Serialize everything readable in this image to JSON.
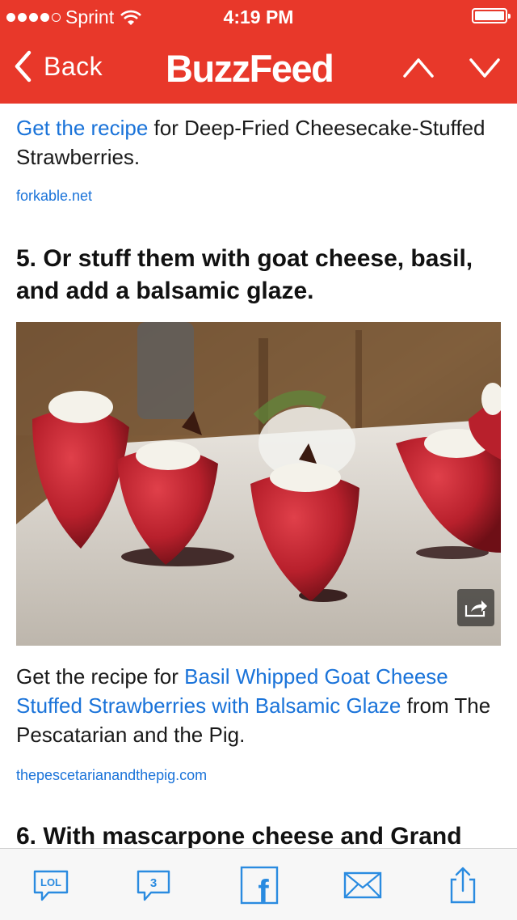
{
  "status": {
    "carrier": "Sprint",
    "time": "4:19 PM",
    "signal_bars": 4
  },
  "nav": {
    "back_label": "Back",
    "logo": "BuzzFeed"
  },
  "article": {
    "item4": {
      "link_text": "Get the recipe",
      "rest_text": " for Deep-Fried Cheesecake-Stuffed Strawberries.",
      "source": "forkable.net"
    },
    "item5": {
      "heading": "5. Or stuff them with goat cheese, basil, and add a balsamic glaze.",
      "image_alt": "Strawberries stuffed with goat cheese and balsamic glaze",
      "prefix": "Get the recipe for ",
      "link_text": "Basil Whipped Goat Cheese Stuffed Strawberries with Balsamic Glaze",
      "suffix": " from The Pescatarian and the Pig.",
      "source": "thepescetarianandthepig.com"
    },
    "item6": {
      "heading": "6. With mascarpone cheese and Grand"
    }
  },
  "toolbar": {
    "lol_label": "LOL",
    "comments_count": "3",
    "facebook_label": "f"
  },
  "colors": {
    "brand": "#e8382a",
    "link": "#1a73d9",
    "toolbar_icon": "#2a8be0"
  }
}
